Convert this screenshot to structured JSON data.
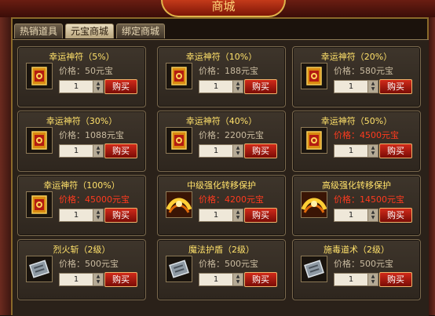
{
  "window": {
    "title": "商城"
  },
  "tabs": [
    "热销道具",
    "元宝商城",
    "绑定商城"
  ],
  "items": [
    {
      "name": "幸运神符（5%）",
      "price": "价格：50元宝",
      "red": false,
      "icon": "scroll-icon",
      "qty": "1"
    },
    {
      "name": "幸运神符（10%）",
      "price": "价格：188元宝",
      "red": false,
      "icon": "scroll-icon",
      "qty": "1"
    },
    {
      "name": "幸运神符（20%）",
      "price": "价格：580元宝",
      "red": false,
      "icon": "scroll-icon",
      "qty": "1"
    },
    {
      "name": "幸运神符（30%）",
      "price": "价格：1088元宝",
      "red": false,
      "icon": "scroll-icon",
      "qty": "1"
    },
    {
      "name": "幸运神符（40%）",
      "price": "价格：2200元宝",
      "red": false,
      "icon": "scroll-icon",
      "qty": "1"
    },
    {
      "name": "幸运神符（50%）",
      "price": "价格：4500元宝",
      "red": true,
      "icon": "scroll-icon",
      "qty": "1"
    },
    {
      "name": "幸运神符（100%）",
      "price": "价格：45000元宝",
      "red": true,
      "icon": "scroll-icon",
      "qty": "1"
    },
    {
      "name": "中级强化转移保护",
      "price": "价格：4200元宝",
      "red": true,
      "icon": "gold-ribbon-icon",
      "qty": "1"
    },
    {
      "name": "高级强化转移保护",
      "price": "价格：14500元宝",
      "red": true,
      "icon": "gold-ribbon-icon",
      "qty": "1"
    },
    {
      "name": "烈火斩（2级）",
      "price": "价格：500元宝",
      "red": false,
      "icon": "skill-book-icon",
      "qty": "1"
    },
    {
      "name": "魔法护盾（2级）",
      "price": "价格：500元宝",
      "red": false,
      "icon": "skill-book-icon",
      "qty": "1"
    },
    {
      "name": "施毒道术（2级）",
      "price": "价格：500元宝",
      "red": false,
      "icon": "skill-book-icon",
      "qty": "1"
    }
  ],
  "buy_label": "购买"
}
